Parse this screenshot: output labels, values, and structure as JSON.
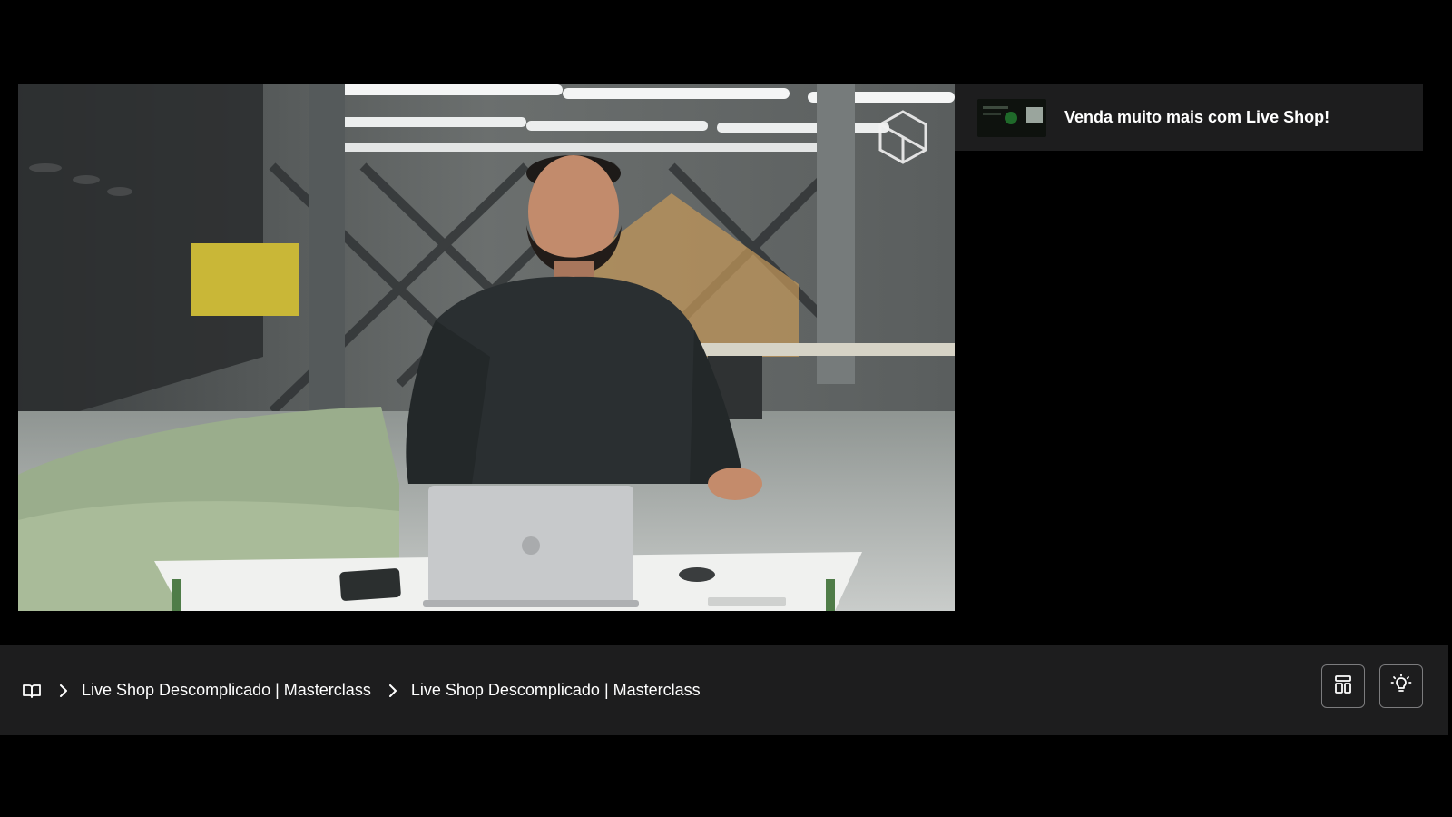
{
  "video": {
    "name": "masterclass-video"
  },
  "playlist": {
    "items": [
      {
        "title": "Venda muito mais com Live Shop!"
      }
    ]
  },
  "breadcrumb": {
    "home_icon": "book-open-icon",
    "separator_icon": "chevron-right-icon",
    "items": [
      {
        "label": "Live Shop Descomplicado | Masterclass"
      },
      {
        "label": "Live Shop Descomplicado | Masterclass"
      }
    ]
  },
  "actions": {
    "layout_icon": "layout-icon",
    "theme_icon": "lightbulb-icon"
  },
  "colors": {
    "background": "#000000",
    "panel": "#1d1d1e",
    "text": "#ffffff",
    "border": "#7c7c7e"
  }
}
